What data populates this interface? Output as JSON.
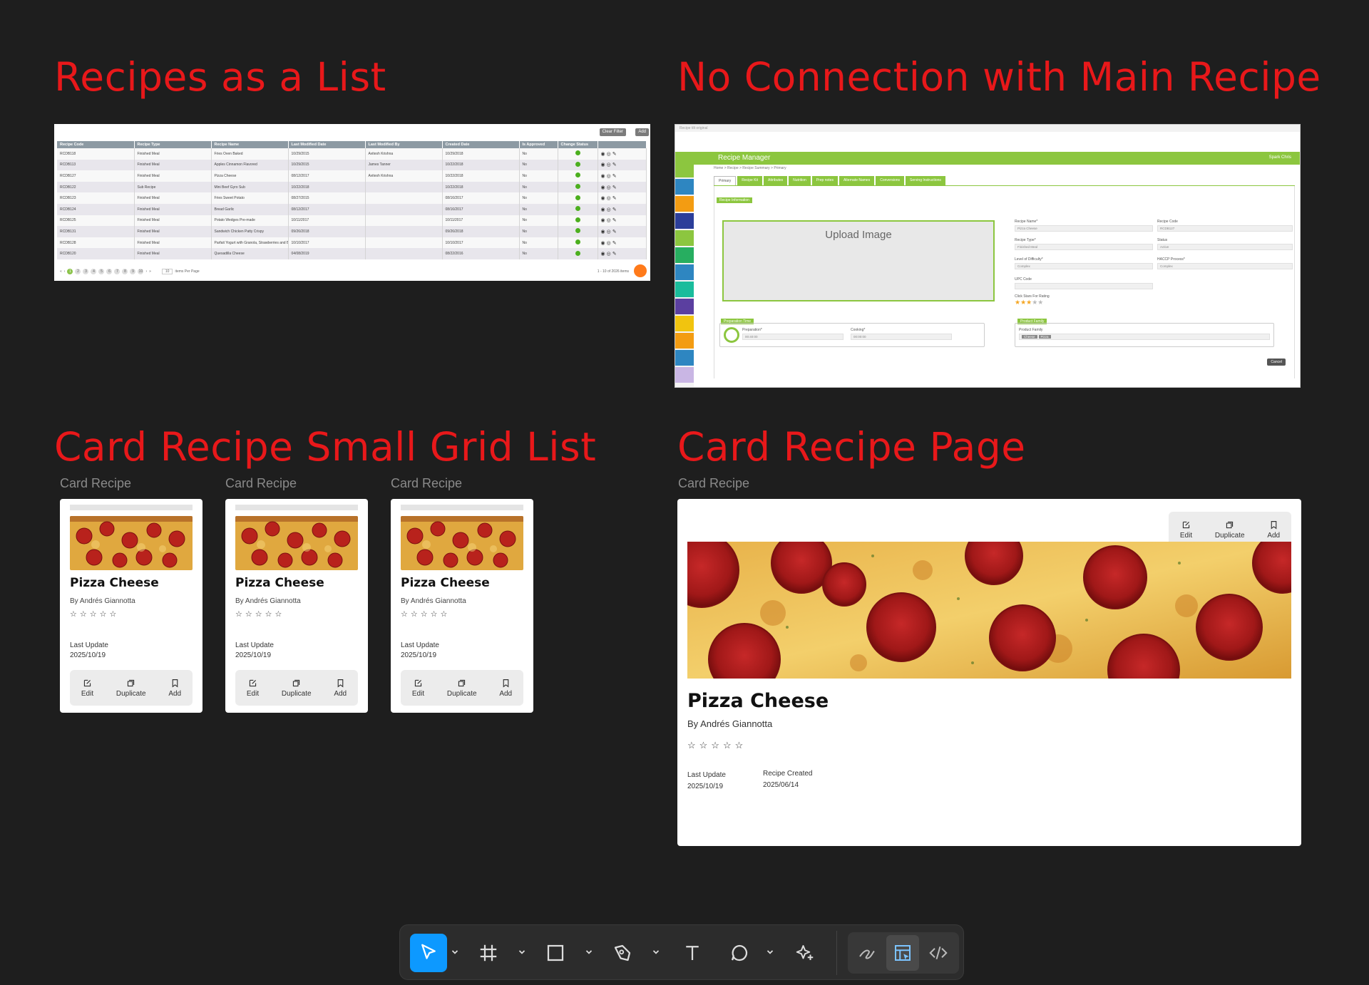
{
  "sections": {
    "list_title": "Recipes as a List",
    "nocon_title": "No Connection with Main Recipe",
    "small_grid_title": "Card Recipe Small Grid List",
    "page_title": "Card Recipe Page"
  },
  "frame_label": "Card Recipe",
  "list_shot": {
    "buttons": [
      "Clear Filter",
      "Add"
    ],
    "columns": [
      "Recipe Code",
      "Recipe Type",
      "Recipe Name",
      "Last Modified Date",
      "Last Modified By",
      "Created Date",
      "Is Approved",
      "Change Status"
    ],
    "rows": [
      [
        "RCDB118",
        "Finished Meal",
        "Fries Oven Baked",
        "10/29/2015",
        "Avitesh Krishna",
        "10/29/2018",
        "No"
      ],
      [
        "RCDB113",
        "Finished Meal",
        "Apples Cinnamon Flavored",
        "10/29/2015",
        "James Tanner",
        "10/22/2018",
        "No"
      ],
      [
        "RCDB127",
        "Finished Meal",
        "Pizza Cheese",
        "08/12/2017",
        "Avitesh Krishna",
        "10/22/2018",
        "No"
      ],
      [
        "RCDB122",
        "Sub Recipe",
        "Mini Beef Gyro Sub",
        "10/22/2018",
        "",
        "10/22/2018",
        "No"
      ],
      [
        "RCDB123",
        "Finished Meal",
        "Fries Sweet Potato",
        "08/27/2015",
        "",
        "08/16/2017",
        "No"
      ],
      [
        "RCDB124",
        "Finished Meal",
        "Bread Garlic",
        "08/12/2017",
        "",
        "08/16/2017",
        "No"
      ],
      [
        "RCDB125",
        "Finished Meal",
        "Potato Wedges Pre-made",
        "10/11/2017",
        "",
        "10/11/2017",
        "No"
      ],
      [
        "RCDB131",
        "Finished Meal",
        "Sandwich Chicken Patty Crispy",
        "09/26/2018",
        "",
        "09/26/2018",
        "No"
      ],
      [
        "RCDB128",
        "Finished Meal",
        "Parfait Yogurt with Granola, Strawberries and Blueberries Lunch",
        "10/10/2017",
        "",
        "10/10/2017",
        "No"
      ],
      [
        "RCDB120",
        "Finished Meal",
        "Quesadilla Cheese",
        "04/08/2019",
        "",
        "08/22/2016",
        "No"
      ]
    ],
    "pages": [
      "1",
      "2",
      "3",
      "4",
      "5",
      "6",
      "7",
      "8",
      "9",
      "10"
    ],
    "per_page": "10",
    "per_page_label": "items Per Page",
    "info": "1 - 10 of 2026 items"
  },
  "mgr_shot": {
    "top_crumb": "Recipe tilt original",
    "title": "Recipe Manager",
    "user": "Spark Chris",
    "crumb": "Home > Recipe > Recipe Summary > Primary",
    "tabs": [
      "Primary",
      "Recipe Kit",
      "Attributes",
      "Nutrition",
      "Prep notes",
      "Alternate Names",
      "Conversions",
      "Serving Instructions"
    ],
    "recipe_info_tag": "Recipe Information",
    "upload": "Upload Image",
    "recipe_name_label": "Recipe Name*",
    "recipe_name_value": "Pizza Cheese",
    "recipe_code_label": "Recipe Code",
    "recipe_code_value": "RCDB127",
    "recipe_type_label": "Recipe Type*",
    "recipe_type_value": "Finished Meal",
    "status_label": "Status",
    "status_value": "Active",
    "difficulty_label": "Level of Difficulty*",
    "difficulty_value": "Complex",
    "haccp_label": "HACCP Process*",
    "haccp_value": "Complex",
    "upc_label": "UPC Code",
    "rating_label": "Click Stars For Rating",
    "rating": 3,
    "prep_tag": "Preparation Time",
    "prep_label": "Preparation*",
    "prep_value": "00:40:00",
    "cook_label": "Cooking*",
    "cook_value": "00:00:00",
    "family_tag": "Product Family",
    "family_label": "Product Family",
    "family_chips": [
      "Cheese",
      "Pizza"
    ],
    "cancel": "Cancel"
  },
  "card": {
    "name": "Pizza Cheese",
    "author": "By Andrés Giannotta",
    "stars": "☆☆☆☆☆",
    "last_update_label": "Last Update",
    "last_update": "2025/10/19",
    "edit": "Edit",
    "duplicate": "Duplicate",
    "add": "Add"
  },
  "bigcard": {
    "name": "Pizza Cheese",
    "author": "By Andrés Giannotta",
    "stars": "☆☆☆☆☆",
    "last_update_label": "Last Update",
    "last_update": "2025/10/19",
    "created_label": "Recipe Created",
    "created": "2025/06/14",
    "edit": "Edit",
    "duplicate": "Duplicate",
    "add": "Add"
  },
  "toolbar": {
    "tools": [
      "move-tool",
      "frame-tool",
      "rectangle-tool",
      "pen-tool",
      "text-tool",
      "comment-tool",
      "ai-tool"
    ],
    "right": [
      "draw-mode",
      "design-mode",
      "dev-mode"
    ],
    "active": "move-tool"
  },
  "colors": {
    "title": "#e8181a",
    "green": "#8cc63f",
    "accent": "#0d99ff"
  }
}
